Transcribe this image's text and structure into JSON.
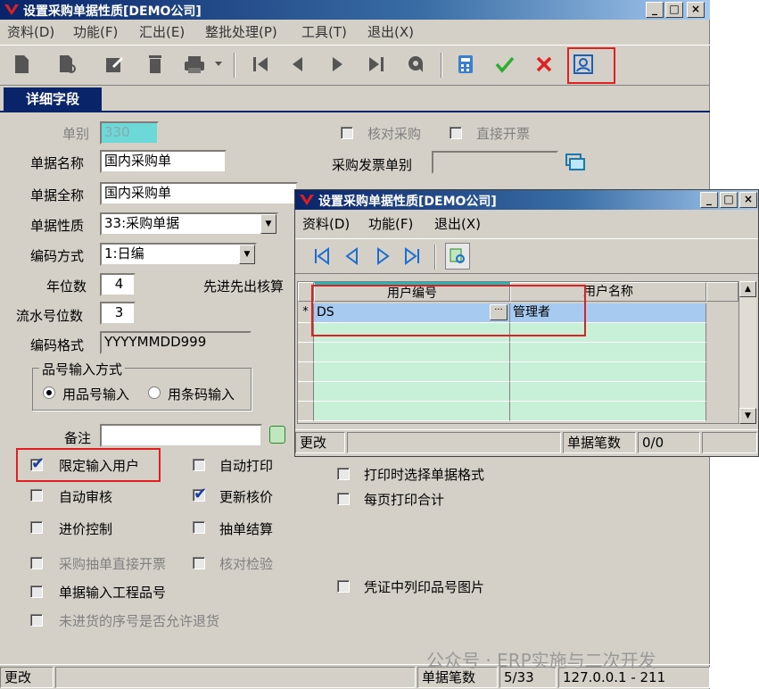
{
  "main": {
    "title": "设置采购单据性质[DEMO公司]",
    "menu": [
      "资料(D)",
      "功能(F)",
      "汇出(E)",
      "整批处理(P)",
      "工具(T)",
      "退出(X)"
    ],
    "tab": "详细字段",
    "labels": {
      "bill_type": "单别",
      "bill_name": "单据名称",
      "bill_fullname": "单据全称",
      "bill_nature": "单据性质",
      "code_method": "编码方式",
      "year_digits": "年位数",
      "serial_digits": "流水号位数",
      "code_format": "编码格式",
      "item_input_mode": "品号输入方式",
      "remark": "备注",
      "purchase_invoice_type": "采购发票单别",
      "fifo_label": "先进先出核算"
    },
    "values": {
      "bill_type": "330",
      "bill_name": "国内采购单",
      "bill_fullname": "国内采购单",
      "bill_nature": "33:采购单据",
      "code_method": "1:日编",
      "year_digits": "4",
      "serial_digits": "3",
      "code_format": "YYYYMMDD999",
      "remark": "",
      "purchase_invoice_type": ""
    },
    "radios": {
      "by_item_no": "用品号输入",
      "by_barcode": "用条码输入"
    },
    "checkboxes": {
      "verify_purchase": "核对采购",
      "direct_invoice": "直接开票",
      "restrict_user": "限定输入用户",
      "auto_print": "自动打印",
      "auto_audit": "自动审核",
      "update_cost": "更新核价",
      "price_control": "进价控制",
      "extract_settle": "抽单结算",
      "purchase_extract_invoice": "采购抽单直接开票",
      "verify_inspect": "核对检验",
      "input_project_item": "单据输入工程品号",
      "return_unreceived": "未进货的序号是否允许退货",
      "select_print_format": "打印时选择单据格式",
      "print_total_per_page": "每页打印合计",
      "voucher_item_image": "凭证中列印品号图片"
    },
    "status": {
      "mode": "更改",
      "count_label": "单据笔数",
      "count": "5/33",
      "server": "127.0.0.1 - 211"
    }
  },
  "dialog": {
    "title": "设置采购单据性质[DEMO公司]",
    "menu": [
      "资料(D)",
      "功能(F)",
      "退出(X)"
    ],
    "columns": [
      "用户编号",
      "用户名称"
    ],
    "rows": [
      {
        "marker": "*",
        "user_id": "DS",
        "user_name": "管理者"
      }
    ],
    "status": {
      "mode": "更改",
      "count_label": "单据笔数",
      "count": "0/0"
    }
  },
  "watermark": "公众号 · ERP实施与二次开发"
}
